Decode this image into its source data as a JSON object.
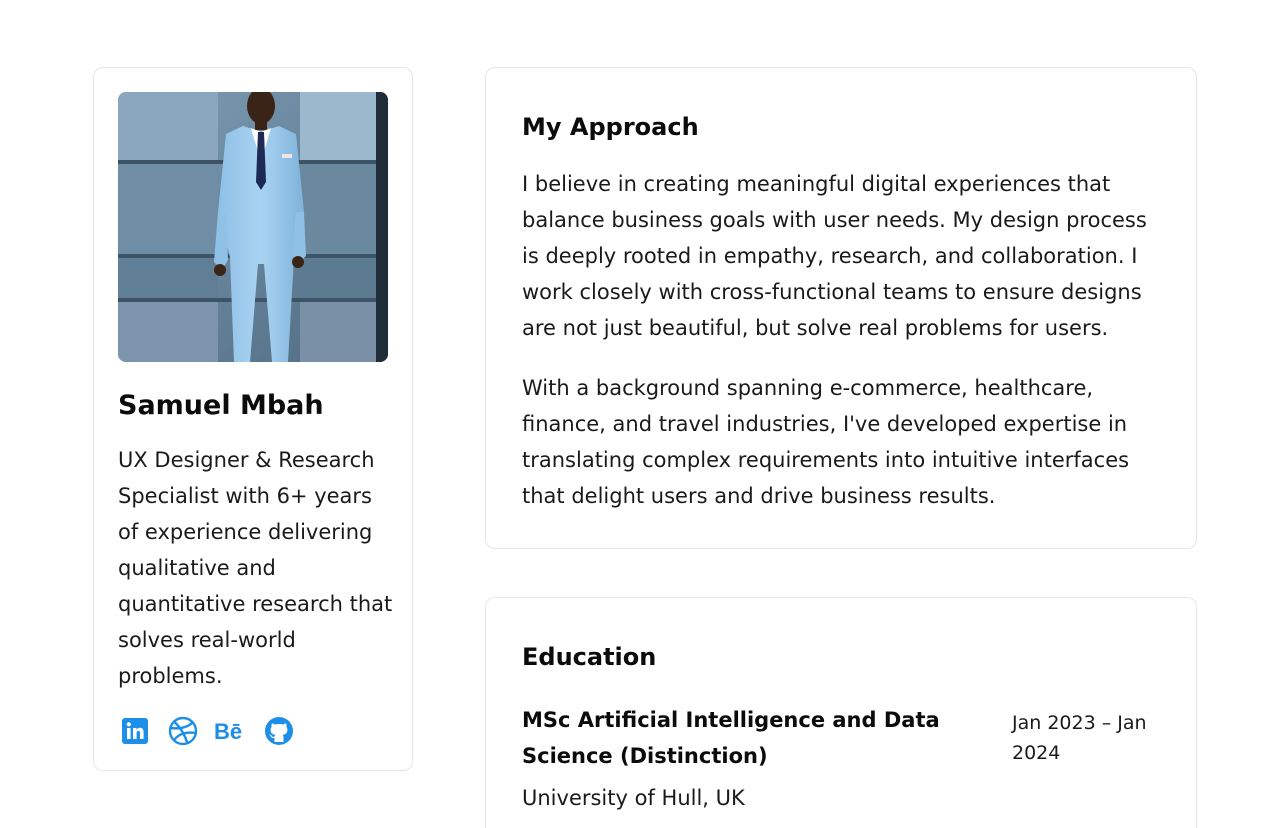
{
  "profile": {
    "name": "Samuel Mbah",
    "bio": "UX Designer & Research Specialist with 6+ years of experience delivering qualitative and quantitative research that solves real-world problems.",
    "social_icons": [
      "linkedin-icon",
      "dribbble-icon",
      "behance-icon",
      "github-icon"
    ],
    "icon_color": "#1d8fe8"
  },
  "approach": {
    "heading": "My Approach",
    "paragraphs": [
      "I believe in creating meaningful digital experiences that balance business goals with user needs. My design process is deeply rooted in empathy, research, and collaboration. I work closely with cross-functional teams to ensure designs are not just beautiful, but solve real problems for users.",
      "With a background spanning e-commerce, healthcare, finance, and travel industries, I've developed expertise in translating complex requirements into intuitive interfaces that delight users and drive business results."
    ]
  },
  "education": {
    "heading": "Education",
    "items": [
      {
        "degree": "MSc Artificial Intelligence and Data Science (Distinction)",
        "dates": "Jan 2023 – Jan 2024",
        "school": "University of Hull, UK"
      }
    ]
  }
}
